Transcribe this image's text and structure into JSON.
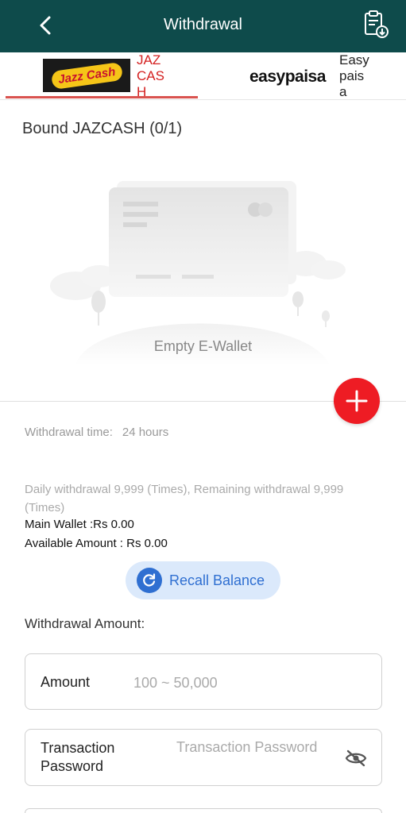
{
  "header": {
    "title": "Withdrawal",
    "back_icon": "chevron-left-icon",
    "record_icon": "clipboard-download-icon",
    "background_color": "#0e4b4b"
  },
  "tabs": [
    {
      "id": "jazzcash",
      "logo_text": "Jazz Cash",
      "label": "JAZCASH",
      "active": true,
      "label_color": "#d42020"
    },
    {
      "id": "easypaisa",
      "logo_text": "easypaisa",
      "label": "Easypaisa",
      "active": false
    }
  ],
  "bound": {
    "title": "Bound JAZCASH (0/1)",
    "empty_label": "Empty E-Wallet"
  },
  "add_button": {
    "icon": "plus-icon",
    "color": "#ee1c24"
  },
  "info": {
    "withdrawal_time_label": "Withdrawal time:",
    "withdrawal_time_value": "24 hours",
    "daily_limit_text": "Daily withdrawal 9,999 (Times), Remaining withdrawal 9,999 (Times)",
    "main_wallet_text": "Main Wallet :Rs 0.00",
    "available_amount_text": "Available Amount : Rs 0.00"
  },
  "recall": {
    "label": "Recall Balance",
    "icon": "refresh-icon",
    "color": "#2f6fd1"
  },
  "form": {
    "section_title": "Withdrawal Amount:",
    "amount_label": "Amount",
    "amount_placeholder": "100 ~ 50,000",
    "password_label": "Transaction Password",
    "password_placeholder": "Transaction Password",
    "visibility_icon": "eye-off-icon"
  }
}
